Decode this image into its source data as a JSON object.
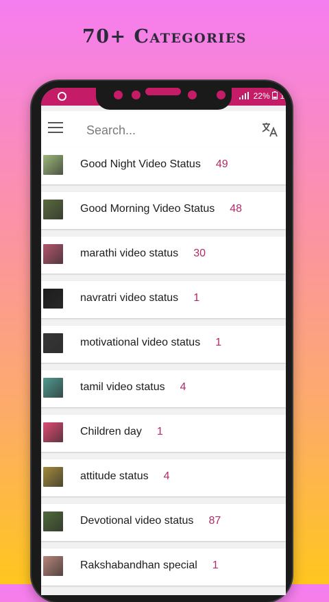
{
  "headline": "70+ Categories",
  "status_bar": {
    "battery": "22%",
    "battery_trail": "1"
  },
  "app_bar": {
    "search_placeholder": "Search..."
  },
  "categories": [
    {
      "title": "Good Night Video Status",
      "count": "49",
      "thumb_color": "#9db87a"
    },
    {
      "title": "Good Morning Video Status",
      "count": "48",
      "thumb_color": "#5a6b3e"
    },
    {
      "title": "marathi video status",
      "count": "30",
      "thumb_color": "#b3566d"
    },
    {
      "title": "navratri video status",
      "count": "1",
      "thumb_color": "#1d1d1d"
    },
    {
      "title": "motivational video status",
      "count": "1",
      "thumb_color": "#363636"
    },
    {
      "title": "tamil video status",
      "count": "4",
      "thumb_color": "#4f9a8f"
    },
    {
      "title": "Children day",
      "count": "1",
      "thumb_color": "#e04b73"
    },
    {
      "title": "attitude status",
      "count": "4",
      "thumb_color": "#a28a3c"
    },
    {
      "title": "Devotional video status",
      "count": "87",
      "thumb_color": "#4f6a3a"
    },
    {
      "title": "Rakshabandhan special",
      "count": "1",
      "thumb_color": "#b7847a"
    }
  ]
}
